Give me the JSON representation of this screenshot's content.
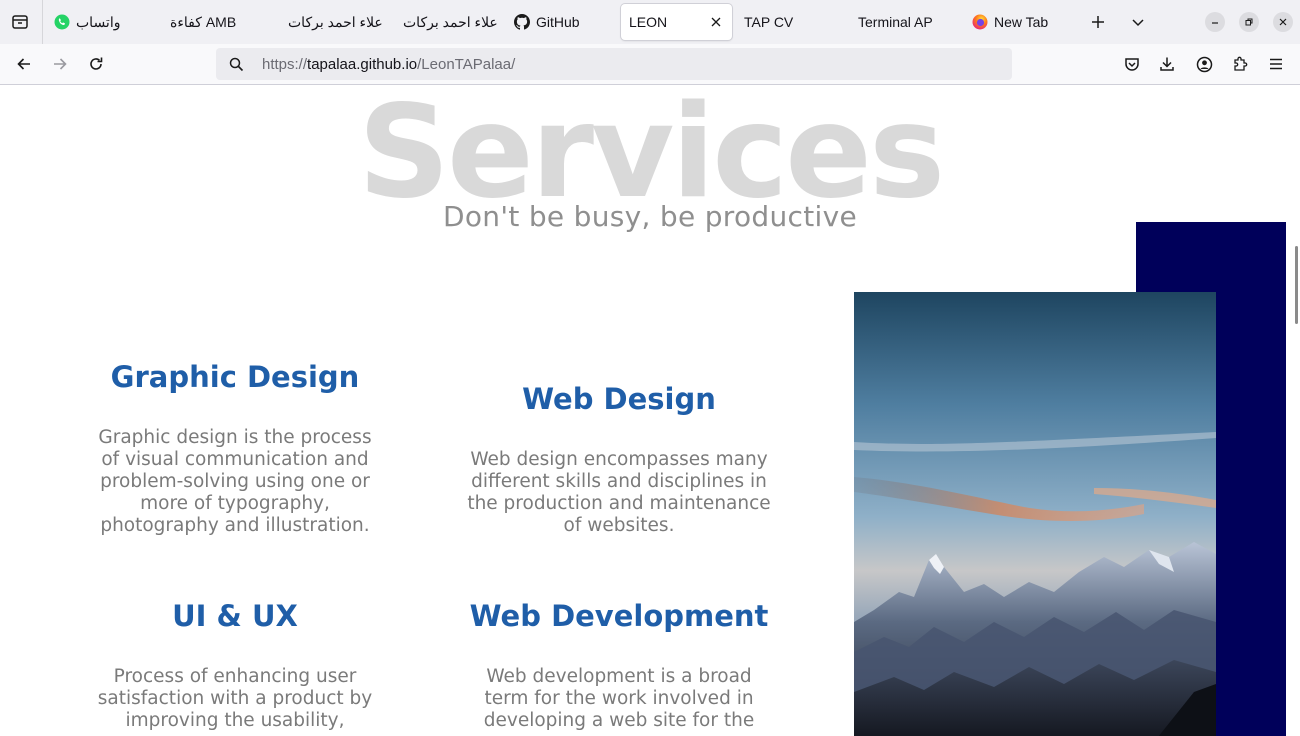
{
  "browser": {
    "tabs": [
      {
        "label": "واتساب",
        "icon": "whatsapp-icon"
      },
      {
        "label": "كفاءة AMB",
        "icon": ""
      },
      {
        "label": "علاء احمد بركات",
        "icon": ""
      },
      {
        "label": "علاء احمد بركات",
        "icon": ""
      },
      {
        "label": "GitHub",
        "icon": "github-icon"
      },
      {
        "label": "LEON",
        "icon": "",
        "active": true
      },
      {
        "label": "TAP CV",
        "icon": ""
      },
      {
        "label": "Terminal AP",
        "icon": ""
      },
      {
        "label": "New Tab",
        "icon": "firefox-icon"
      }
    ],
    "url": {
      "scheme": "https://",
      "host": "tapalaa.github.io",
      "path": "/LeonTAPalaa/"
    },
    "colors": {
      "accent": "#1f5ea8",
      "navy": "#00005a",
      "whatsapp": "#25d366"
    }
  },
  "page": {
    "background_title": "Services",
    "subtitle": "Don't be busy, be productive",
    "services": [
      {
        "title": "Graphic Design",
        "description": "Graphic design is the process of visual communication and problem-solving using one or more of typography, photography and illustration."
      },
      {
        "title": "Web Design",
        "description": "Web design encompasses many different skills and disciplines in the production and maintenance of websites."
      },
      {
        "title": "UI & UX",
        "description": "Process of enhancing user satisfaction with a product by improving the usability,"
      },
      {
        "title": "Web Development",
        "description": "Web development is a broad term for the work involved in developing a web site for the"
      }
    ]
  }
}
